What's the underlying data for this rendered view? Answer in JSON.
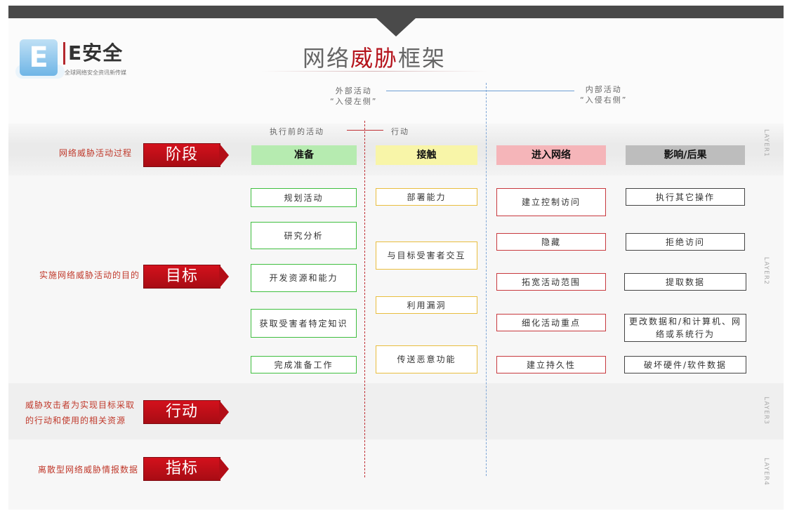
{
  "logo": {
    "mark": "E",
    "name": "E安全",
    "tagline": "全球网络安全资讯新传媒"
  },
  "title": {
    "part1": "网络",
    "highlight": "威胁",
    "part2": "框架"
  },
  "outside": {
    "line1": "外部活动",
    "line2": "“入侵左侧”"
  },
  "inside": {
    "line1": "内部活动",
    "line2": "“入侵右侧”"
  },
  "pre_activity": "执行前的活动",
  "action_label": "行动",
  "rows": [
    {
      "desc": "网络威胁活动过程",
      "arrow": "阶段"
    },
    {
      "desc": "实施网络威胁活动的目的",
      "arrow": "目标"
    },
    {
      "desc_line1": "威胁攻击者为实现目标采取",
      "desc_line2": "的行动和使用的相关资源",
      "arrow": "行动"
    },
    {
      "desc": "离散型网络威胁情报数据",
      "arrow": "指标"
    }
  ],
  "phases": [
    "准备",
    "接触",
    "进入网络",
    "影响/后果"
  ],
  "columns": {
    "prepare": [
      "规划活动",
      "研究分析",
      "开发资源和能力",
      "获取受害者特定知识",
      "完成准备工作"
    ],
    "engage": [
      "部署能力",
      "与目标受害者交互",
      "利用漏洞",
      "传送恶意功能"
    ],
    "presence": [
      "建立控制访问",
      "隐藏",
      "拓宽活动范围",
      "细化活动重点",
      "建立持久性"
    ],
    "effect": [
      "执行其它操作",
      "拒绝访问",
      "提取数据",
      "更改数据和/和计算机、网络或系统行为",
      "破坏硬件/软件数据"
    ]
  },
  "layers": [
    "LAYER1",
    "LAYER2",
    "LAYER3",
    "LAYER4"
  ],
  "colors": {
    "accent_red": "#b4121b",
    "green": "#3fbf3f",
    "yellow": "#e9be3f",
    "gray": "#bdbdbd"
  }
}
